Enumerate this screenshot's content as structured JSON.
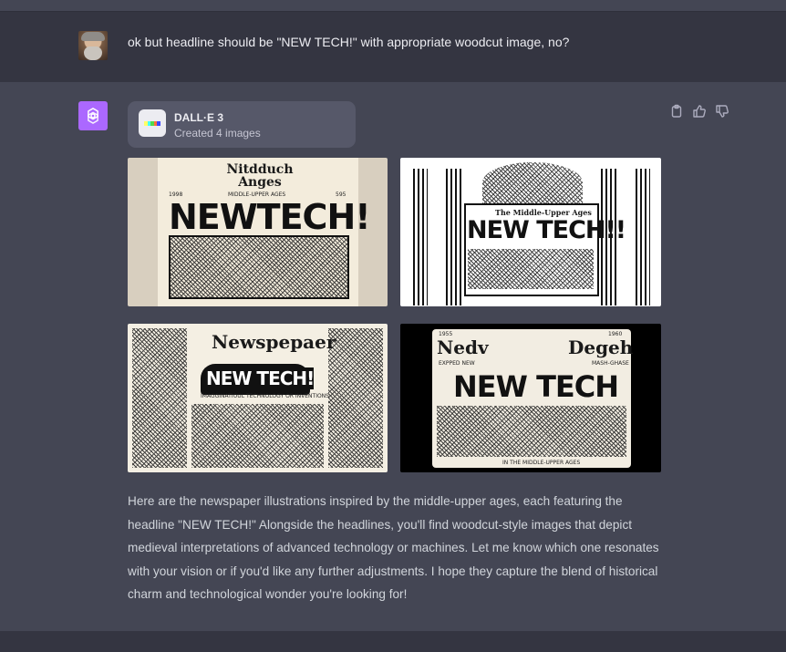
{
  "user_message": {
    "text": "ok but headline should be \"NEW TECH!\" with appropriate woodcut image, no?"
  },
  "assistant": {
    "tool_card": {
      "name": "DALL·E 3",
      "status": "Created 4 images"
    },
    "images": [
      {
        "masthead": "Nitdduch Anges",
        "sub": "MIDDLE-UPPER AGES",
        "headline": "NEWTECH!",
        "left_tag": "1998",
        "right_tag": "595"
      },
      {
        "masthead": "The Middle-Upper Ages",
        "headline": "NEW TECH!!"
      },
      {
        "masthead": "Newspepaer",
        "headline": "NEW TECH!",
        "sub": "IMAGGINATIOUL TECHNOLOGY OR INVENTIONS"
      },
      {
        "masthead_left": "Nedv",
        "masthead_right": "Degeh",
        "headline": "NEW TECH",
        "left_tag": "EXPPED NEW",
        "right_tag": "MASH-GHASE",
        "sub": "IN THE MIDDLE-UPPER AGES",
        "top_left": "1955",
        "top_right": "1960"
      }
    ],
    "response_text": "Here are the newspaper illustrations inspired by the middle-upper ages, each featuring the headline \"NEW TECH!\" Alongside the headlines, you'll find woodcut-style images that depict medieval interpretations of advanced technology or machines. Let me know which one resonates with your vision or if you'd like any further adjustments. I hope they capture the blend of historical charm and technological wonder you're looking for!",
    "actions": [
      "clipboard-icon",
      "thumbs-up-icon",
      "thumbs-down-icon"
    ]
  },
  "colors": {
    "user_bg": "#343541",
    "assistant_bg": "#444654",
    "gpt_icon": "#ab68ff"
  }
}
